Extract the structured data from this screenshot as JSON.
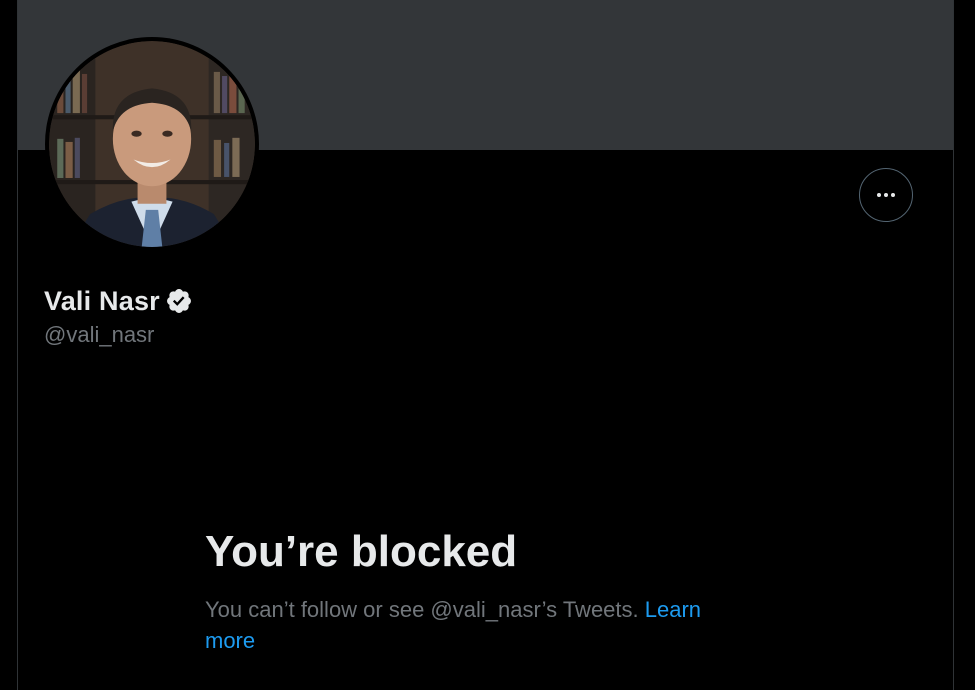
{
  "profile": {
    "display_name": "Vali Nasr",
    "handle": "@vali_nasr",
    "verified": true
  },
  "blocked": {
    "title": "You’re blocked",
    "message": "You can’t follow or see @vali_nasr’s Tweets.",
    "learn_more": "Learn more"
  },
  "icons": {
    "more": "more-horizontal-icon",
    "verified": "verified-badge-icon"
  },
  "colors": {
    "background": "#000000",
    "banner": "#333639",
    "primary_text": "#e7e9ea",
    "secondary_text": "#71767b",
    "link": "#1d9bf0"
  }
}
